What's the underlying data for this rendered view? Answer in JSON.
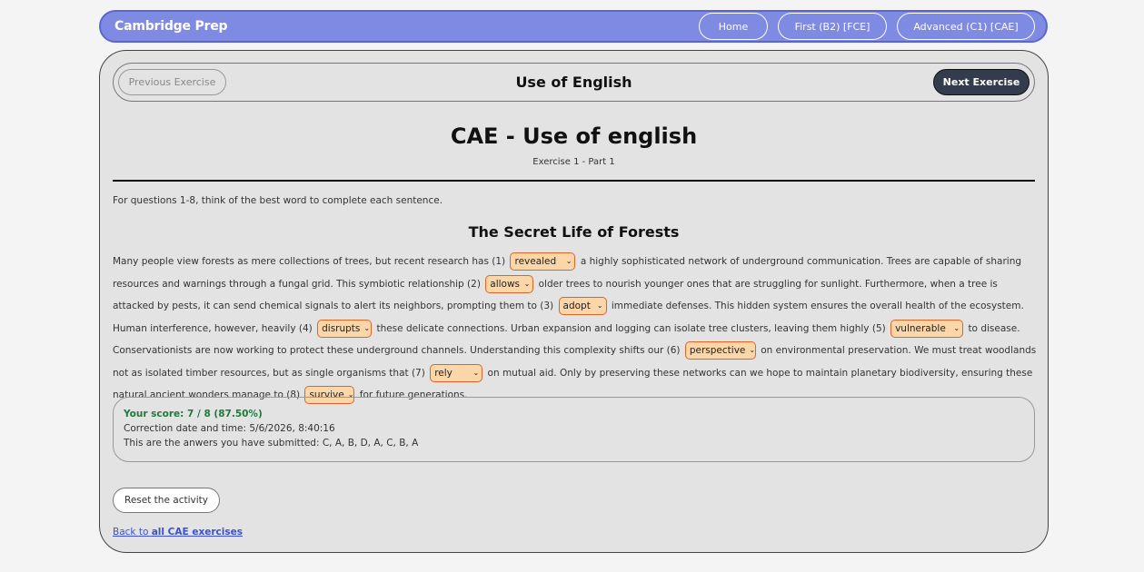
{
  "nav": {
    "brand": "Cambridge Prep",
    "links": [
      "Home",
      "First (B2) [FCE]",
      "Advanced (C1) [CAE]"
    ]
  },
  "exercise_bar": {
    "prev_label": "Previous Exercise",
    "title": "Use of English",
    "next_label": "Next Exercise"
  },
  "page": {
    "title": "CAE - Use of english",
    "subtitle": "Exercise 1 - Part 1",
    "instructions": "For questions 1-8, think of the best word to complete each sentence.",
    "text_title": "The Secret Life of Forests"
  },
  "passage": {
    "s0": "Many people view forests as mere collections of trees, but recent research has (1)",
    "g1": "revealed",
    "s1": "a highly sophisticated network of underground communication. Trees are capable of sharing resources and warnings through a fungal grid. This symbiotic relationship (2)",
    "g2": "allows",
    "s2": "older trees to nourish younger ones that are struggling for sunlight. Furthermore, when a tree is attacked by pests, it can send chemical signals to alert its neighbors, prompting them to (3)",
    "g3": "adopt",
    "s3": "immediate defenses. This hidden system ensures the overall health of the ecosystem. Human interference, however, heavily (4)",
    "g4": "disrupts",
    "s4": "these delicate connections. Urban expansion and logging can isolate tree clusters, leaving them highly (5)",
    "g5": "vulnerable",
    "s5": "to disease. Conservationists are now working to protect these underground channels. Understanding this complexity shifts our (6)",
    "g6": "perspective",
    "s6": "on environmental preservation. We must treat woodlands not as isolated timber resources, but as single organisms that (7)",
    "g7": "rely",
    "s7": "on mutual aid. Only by preserving these networks can we hope to maintain planetary biodiversity, ensuring these natural ancient wonders manage to (8)",
    "g8": "survive",
    "s8": "for future generations."
  },
  "result": {
    "score": "Your score: 7 / 8 (87.50%)",
    "correction": "Correction date and time: 5/6/2026, 8:40:16",
    "answers": "This are the anwers you have submitted: C, A, B, D, A, C, B, A"
  },
  "actions": {
    "reset_label": "Reset the activity",
    "back_prefix": "Back to ",
    "back_bold": "all CAE exercises"
  },
  "colors": {
    "navbar": "#7f8ae2",
    "gap_fill": "#fbd6a8",
    "gap_border": "#e0632a",
    "score_green": "#1f7a3a",
    "next_button": "#333c4d",
    "link": "#3b4fd8"
  }
}
